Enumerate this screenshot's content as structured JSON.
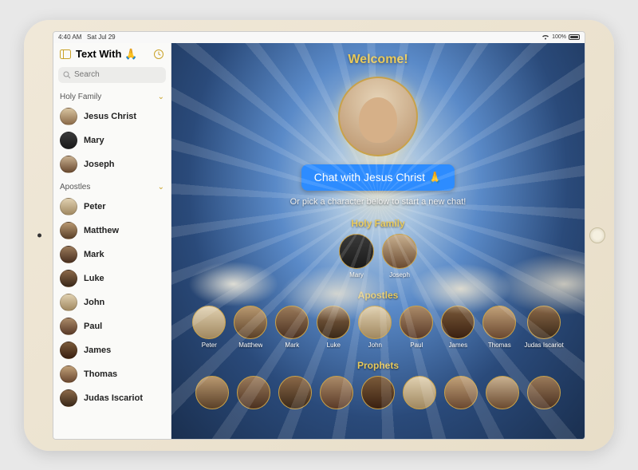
{
  "status": {
    "time": "4:40 AM",
    "date": "Sat Jul 29",
    "battery_pct": "100%"
  },
  "header": {
    "app_title": "Text With 🙏",
    "sidebar_icon": "sidebar-toggle-icon",
    "clock_icon": "history-icon"
  },
  "search": {
    "placeholder": "Search"
  },
  "sidebar": {
    "sections": [
      {
        "title": "Holy Family",
        "items": [
          {
            "name": "Jesus Christ"
          },
          {
            "name": "Mary"
          },
          {
            "name": "Joseph"
          }
        ]
      },
      {
        "title": "Apostles",
        "items": [
          {
            "name": "Peter"
          },
          {
            "name": "Matthew"
          },
          {
            "name": "Mark"
          },
          {
            "name": "Luke"
          },
          {
            "name": "John"
          },
          {
            "name": "Paul"
          },
          {
            "name": "James"
          },
          {
            "name": "Thomas"
          },
          {
            "name": "Judas Iscariot"
          }
        ]
      }
    ]
  },
  "main": {
    "welcome": "Welcome!",
    "hero_character": "Jesus Christ",
    "cta_label": "Chat with Jesus Christ 🙏",
    "subtext": "Or pick a character below to start a new chat!",
    "groups": [
      {
        "title": "Holy Family",
        "characters": [
          {
            "name": "Mary"
          },
          {
            "name": "Joseph"
          }
        ]
      },
      {
        "title": "Apostles",
        "characters": [
          {
            "name": "Peter"
          },
          {
            "name": "Matthew"
          },
          {
            "name": "Mark"
          },
          {
            "name": "Luke"
          },
          {
            "name": "John"
          },
          {
            "name": "Paul"
          },
          {
            "name": "James"
          },
          {
            "name": "Thomas"
          },
          {
            "name": "Judas Iscariot"
          }
        ]
      },
      {
        "title": "Prophets",
        "characters": [
          {
            "name": ""
          },
          {
            "name": ""
          },
          {
            "name": ""
          },
          {
            "name": ""
          },
          {
            "name": ""
          },
          {
            "name": ""
          },
          {
            "name": ""
          },
          {
            "name": ""
          },
          {
            "name": ""
          }
        ]
      }
    ]
  },
  "colors": {
    "accent_gold": "#c9a227",
    "cta_blue": "#2d8cff"
  }
}
